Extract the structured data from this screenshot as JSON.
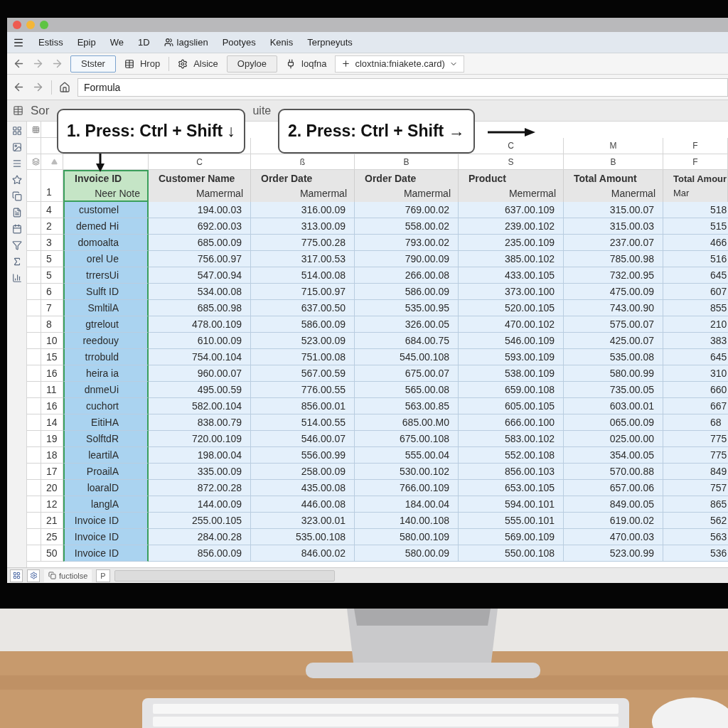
{
  "menu": [
    "Estiss",
    "Epip",
    "We",
    "1D",
    "lagslien",
    "Pootyes",
    "Kenis",
    "Terpneyuts"
  ],
  "toolbar": [
    {
      "kind": "button",
      "label": "Stster",
      "selected": true
    },
    {
      "kind": "tool",
      "label": "Hrop"
    },
    {
      "kind": "tool",
      "label": "Alsice"
    },
    {
      "kind": "button",
      "label": "Opyloe",
      "selected": false
    },
    {
      "kind": "tool",
      "label": "loqfna"
    },
    {
      "kind": "dropdown",
      "label": "cloxtnia:fniakete.card)"
    }
  ],
  "address": {
    "value": "Formula"
  },
  "section": {
    "title": "Sor",
    "tail": "uite"
  },
  "callouts": [
    {
      "text": "1. Press: Ctrl + Shift ↓",
      "kind": "down"
    },
    {
      "text": "2. Press: Ctrl + Shift →",
      "kind": "right"
    }
  ],
  "columns": [
    {
      "name": "Invoice ID",
      "subtitle": "Neer Note",
      "selected": true
    },
    {
      "name": "Customer Name",
      "subtitle": "Mamermal",
      "letter_2": "C",
      "selected": false
    },
    {
      "name": "Order Date",
      "subtitle": "Mamermal",
      "letter_2": "ß",
      "selected": false
    },
    {
      "name": "Order Date",
      "subtitle": "Mamermal",
      "letter_2": "B",
      "selected": false
    },
    {
      "name": "Product",
      "subtitle": "Memermal",
      "letter": "C",
      "letter_2": "S",
      "selected": false
    },
    {
      "name": "Total Amount",
      "subtitle": "Manermal",
      "letter": "M",
      "letter_2": "B",
      "selected": false
    },
    {
      "name": "Total Amour",
      "subtitle": "Mar",
      "letter": "F",
      "letter_2": "F",
      "selected": false
    }
  ],
  "header_row_number": "1",
  "rows": [
    {
      "number": "4",
      "cells": [
        "customel",
        "194.00.03",
        "316.00.09",
        "769.00.02",
        "637.00.109",
        "315.00.07",
        "518"
      ]
    },
    {
      "number": "2",
      "cells": [
        "demed Hi",
        "692.00.03",
        "313.00.09",
        "558.00.02",
        "239.00.102",
        "315.00.03",
        "515"
      ]
    },
    {
      "number": "3",
      "cells": [
        "domoalta",
        "685.00.09",
        "775.00.28",
        "793.00.02",
        "235.00.109",
        "237.00.07",
        "466"
      ]
    },
    {
      "number": "5",
      "cells": [
        "orel Ue",
        "756.00.97",
        "317.00.53",
        "790.00.09",
        "385.00.102",
        "785.00.98",
        "516"
      ]
    },
    {
      "number": "5",
      "cells": [
        "trrersUi",
        "547.00.94",
        "514.00.08",
        "266.00.08",
        "433.00.105",
        "732.00.95",
        "645"
      ]
    },
    {
      "number": "6",
      "cells": [
        "Sulft ID",
        "534.00.08",
        "715.00.97",
        "586.00.09",
        "373.00.100",
        "475.00.09",
        "607"
      ]
    },
    {
      "number": "7",
      "cells": [
        "SmltilA",
        "685.00.98",
        "637.00.50",
        "535.00.95",
        "520.00.105",
        "743.00.90",
        "855"
      ]
    },
    {
      "number": "8",
      "cells": [
        "gtrelout",
        "478.00.109",
        "586.00.09",
        "326.00.05",
        "470.00.102",
        "575.00.07",
        "210"
      ]
    },
    {
      "number": "10",
      "cells": [
        "reedouy",
        "610.00.09",
        "523.00.09",
        "684.00.75",
        "546.00.109",
        "425.00.07",
        "383"
      ]
    },
    {
      "number": "15",
      "cells": [
        "trrobuld",
        "754.00.104",
        "751.00.08",
        "545.00.108",
        "593.00.109",
        "535.00.08",
        "645"
      ]
    },
    {
      "number": "16",
      "cells": [
        "heira ia",
        "960.00.07",
        "567.00.59",
        "675.00.07",
        "538.00.109",
        "580.00.99",
        "310"
      ]
    },
    {
      "number": "11",
      "cells": [
        "dnmeUi",
        "495.00.59",
        "776.00.55",
        "565.00.08",
        "659.00.108",
        "735.00.05",
        "660"
      ]
    },
    {
      "number": "16",
      "cells": [
        "cuchort",
        "582.00.104",
        "856.00.01",
        "563.00.85",
        "605.00.105",
        "603.00.01",
        "667"
      ]
    },
    {
      "number": "14",
      "cells": [
        "EitiHA",
        "838.00.79",
        "514.00.55",
        "685.00.M0",
        "666.00.100",
        "065.00.09",
        "68"
      ]
    },
    {
      "number": "19",
      "cells": [
        "SolftdR",
        "720.00.109",
        "546.00.07",
        "675.00.108",
        "583.00.102",
        "025.00.00",
        "775"
      ]
    },
    {
      "number": "18",
      "cells": [
        "leartilA",
        "198.00.04",
        "556.00.99",
        "555.00.04",
        "552.00.108",
        "354.00.05",
        "775"
      ]
    },
    {
      "number": "17",
      "cells": [
        "ProailA",
        "335.00.09",
        "258.00.09",
        "530.00.102",
        "856.00.103",
        "570.00.88",
        "849"
      ]
    },
    {
      "number": "20",
      "cells": [
        "loaralD",
        "872.00.28",
        "435.00.08",
        "766.00.109",
        "653.00.105",
        "657.00.06",
        "757"
      ]
    },
    {
      "number": "12",
      "cells": [
        "langlA",
        "144.00.09",
        "446.00.08",
        "184.00.04",
        "594.00.101",
        "849.00.05",
        "865"
      ]
    },
    {
      "number": "21",
      "cells": [
        "Invoice ID",
        "255.00.105",
        "323.00.01",
        "140.00.108",
        "555.00.101",
        "619.00.02",
        "562"
      ]
    },
    {
      "number": "25",
      "cells": [
        "Invoice ID",
        "284.00.28",
        "535.00.108",
        "580.00.109",
        "569.00.109",
        "470.00.03",
        "563"
      ]
    },
    {
      "number": "50",
      "cells": [
        "Invoice ID",
        "856.00.09",
        "846.00.02",
        "580.00.09",
        "550.00.108",
        "523.00.99",
        "536"
      ]
    }
  ],
  "sheet_tabs": [
    {
      "label": "fuctiolse",
      "selected": true
    },
    {
      "label": "P",
      "selected": false
    }
  ]
}
